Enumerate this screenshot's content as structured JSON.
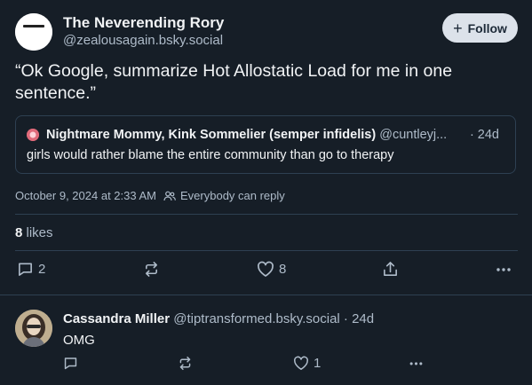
{
  "post": {
    "author_name": "The Neverending Rory",
    "author_handle": "@zealousagain.bsky.social",
    "follow_label": "Follow",
    "text": "“Ok Google, summarize Hot Allostatic Load for me in one sentence.”",
    "quote": {
      "name": "Nightmare Mommy, Kink Sommelier (semper infidelis)",
      "handle": "@cuntleyj...",
      "time": "· 24d",
      "text": "girls would rather blame the entire community than go to therapy"
    },
    "timestamp": "October 9, 2024 at 2:33 AM",
    "reply_setting": "Everybody can reply",
    "likes_count": "8",
    "likes_label": "likes",
    "actions": {
      "replies": "2",
      "reposts": "",
      "likes": "8"
    }
  },
  "reply": {
    "name": "Cassandra Miller",
    "handle": "@tiptransformed.bsky.social",
    "time": "· 24d",
    "text": "OMG",
    "actions": {
      "replies": "",
      "reposts": "",
      "likes": "1"
    }
  },
  "icons": {
    "reply": "speech-bubble-icon",
    "repost": "repost-arrows-icon",
    "like": "heart-icon",
    "share": "share-icon",
    "more": "ellipsis-icon",
    "audience": "people-icon"
  },
  "colors": {
    "background": "#161e27",
    "text": "#f1f3f5",
    "muted": "#aebbc9",
    "border": "#2e4052",
    "follow_bg": "#dce2ea"
  }
}
